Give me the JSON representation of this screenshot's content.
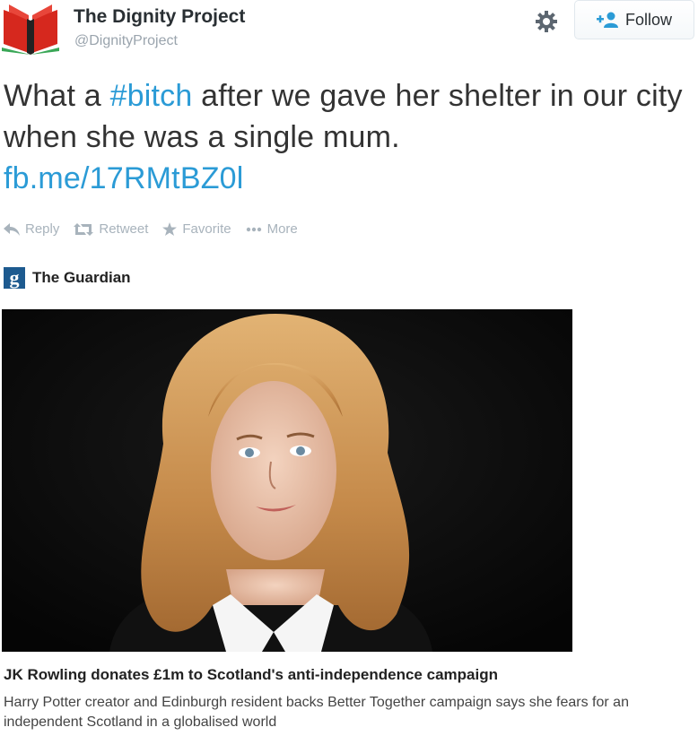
{
  "account": {
    "name": "The Dignity Project",
    "handle": "@DignityProject",
    "avatar_icon": "red-book-logo-icon"
  },
  "header": {
    "settings_icon": "gear-icon",
    "follow_label": "Follow",
    "follow_icon": "add-user-icon"
  },
  "tweet": {
    "text_before": "What a ",
    "hashtag": "#bitch",
    "text_after": " after we gave her shelter in our city when she was a single mum.",
    "link": "fb.me/17RMtBZ0l",
    "link_color": "#2b9bd6"
  },
  "actions": [
    {
      "label": "Reply",
      "icon": "reply-icon"
    },
    {
      "label": "Retweet",
      "icon": "retweet-icon"
    },
    {
      "label": "Favorite",
      "icon": "star-icon"
    },
    {
      "label": "More",
      "icon": "more-dots-icon"
    }
  ],
  "card": {
    "source_logo": "g",
    "source_name": "The Guardian",
    "title": "JK Rowling donates £1m to Scotland's anti-independence campaign",
    "description": "Harry Potter creator and Edinburgh resident backs Better Together campaign says she fears for an independent Scotland in a globalised world"
  }
}
